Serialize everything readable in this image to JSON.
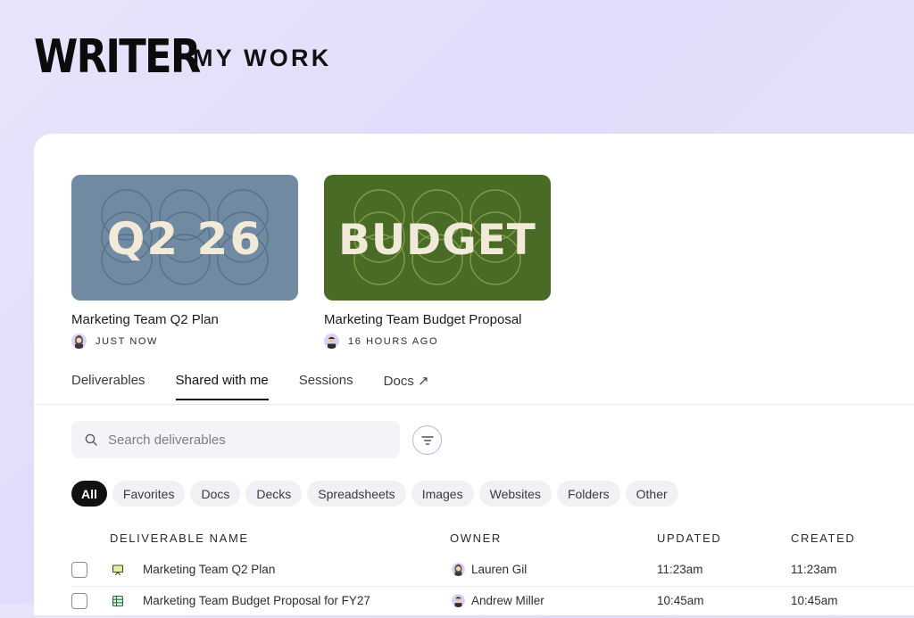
{
  "header": {
    "brand": "WRITER",
    "title": "MY WORK"
  },
  "recent": [
    {
      "thumb_text": "Q2 26",
      "title": "Marketing Team Q2 Plan",
      "meta": "JUST NOW",
      "color": "#6f8aa1"
    },
    {
      "thumb_text": "BUDGET",
      "title": "Marketing Team Budget Proposal",
      "meta": "16 HOURS AGO",
      "color": "#4a6b25"
    }
  ],
  "tabs": [
    {
      "label": "Deliverables"
    },
    {
      "label": "Shared with me",
      "active": true
    },
    {
      "label": "Sessions"
    },
    {
      "label": "Docs ↗"
    }
  ],
  "search": {
    "placeholder": "Search deliverables",
    "icon": "search-icon"
  },
  "filter": {
    "icon": "filter-icon"
  },
  "chips": [
    {
      "label": "All",
      "active": true
    },
    {
      "label": "Favorites"
    },
    {
      "label": "Docs"
    },
    {
      "label": "Decks"
    },
    {
      "label": "Spreadsheets"
    },
    {
      "label": "Images"
    },
    {
      "label": "Websites"
    },
    {
      "label": "Folders"
    },
    {
      "label": "Other"
    }
  ],
  "table": {
    "columns": [
      "DELIVERABLE NAME",
      "OWNER",
      "UPDATED",
      "CREATED"
    ],
    "rows": [
      {
        "name": "Marketing Team Q2 Plan",
        "owner": "Lauren Gil",
        "updated": "11:23am",
        "created": "11:23am",
        "icon": "presentation-icon"
      },
      {
        "name": "Marketing Team Budget Proposal for FY27",
        "owner": "Andrew Miller",
        "updated": "10:45am",
        "created": "10:45am",
        "icon": "spreadsheet-icon"
      }
    ]
  },
  "colors": {
    "accent": "#b9b0f2",
    "card_blue": "#6f8aa1",
    "card_green": "#4a6b25",
    "thumb_text": "#f1ead8"
  }
}
